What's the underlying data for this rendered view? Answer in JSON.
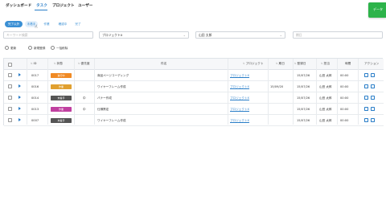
{
  "nav": {
    "items": [
      "ダッシュボード",
      "タスク",
      "プロジェクト",
      "ユーザー"
    ],
    "action_label": "データ"
  },
  "filters": {
    "status_pills": [
      "完了以外",
      "未着手",
      "作業",
      "確認中",
      "完了"
    ],
    "search_placeholder": "キーワード検索",
    "project_select": "プロジェクトX",
    "user_select": "山田 太郎",
    "date_placeholder": "期日"
  },
  "actions": {
    "update": "更新",
    "new": "新規登録",
    "bulk_delete": "一括削除"
  },
  "table": {
    "headers": [
      "ID",
      "状態",
      "優先度",
      "件名",
      "プロジェクト",
      "期日",
      "登録日",
      "担当",
      "時間",
      "アクション"
    ],
    "rows": [
      {
        "id": "0017",
        "status": "進行中",
        "status_color": "#f08a24",
        "priority": "",
        "title": "商品ページコーディング",
        "project": "プロジェクトX",
        "due": "",
        "created": "15/07/26",
        "assignee": "山田 太郎",
        "time": "00:00"
      },
      {
        "id": "0016",
        "status": "作業",
        "status_color": "#e0a030",
        "priority": "",
        "title": "ワイヤーフレーム作成",
        "project": "プロジェクトX",
        "due": "15/09/20",
        "created": "15/07/26",
        "assignee": "山田 太郎",
        "time": "00:00"
      },
      {
        "id": "0014",
        "status": "未着手",
        "status_color": "#555555",
        "priority": "中",
        "title": "バナー作成",
        "project": "プロジェクトX",
        "due": "",
        "created": "15/07/26",
        "assignee": "山田 太郎",
        "time": "00:00"
      },
      {
        "id": "0013",
        "status": "作業",
        "status_color": "#c040a0",
        "priority": "中",
        "title": "仕様策定",
        "project": "プロジェクトX",
        "due": "",
        "created": "15/07/26",
        "assignee": "山田 太郎",
        "time": "00:00"
      },
      {
        "id": "0007",
        "status": "未着手",
        "status_color": "#555555",
        "priority": "",
        "title": "ワイヤーフレーム作成",
        "project": "プロジェクトX",
        "due": "",
        "created": "15/07/26",
        "assignee": "山田 太郎",
        "time": "00:00"
      }
    ]
  },
  "colors": {
    "accent": "#2a7ec8",
    "green": "#2db34a"
  }
}
